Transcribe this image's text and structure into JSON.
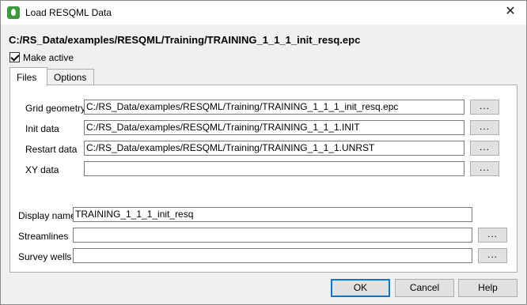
{
  "window": {
    "title": "Load RESQML Data",
    "close_label": "✕"
  },
  "filepath": "C:/RS_Data/examples/RESQML/Training/TRAINING_1_1_1_init_resq.epc",
  "make_active": {
    "label": "Make active",
    "checked": true
  },
  "tabs": [
    {
      "label": "Files",
      "active": true
    },
    {
      "label": "Options",
      "active": false
    }
  ],
  "files": {
    "grid_geometry": {
      "label": "Grid geometry",
      "value": "C:/RS_Data/examples/RESQML/Training/TRAINING_1_1_1_init_resq.epc"
    },
    "init_data": {
      "label": "Init data",
      "value": "C:/RS_Data/examples/RESQML/Training/TRAINING_1_1_1.INIT"
    },
    "restart_data": {
      "label": "Restart data",
      "value": "C:/RS_Data/examples/RESQML/Training/TRAINING_1_1_1.UNRST"
    },
    "xy_data": {
      "label": "XY data",
      "value": ""
    },
    "display_name": {
      "label": "Display name",
      "value": "TRAINING_1_1_1_init_resq"
    },
    "streamlines": {
      "label": "Streamlines",
      "value": ""
    },
    "survey_wells": {
      "label": "Survey wells",
      "value": ""
    },
    "browse_label": "..."
  },
  "buttons": {
    "ok": "OK",
    "cancel": "Cancel",
    "help": "Help"
  },
  "colors": {
    "accent": "#0078d7",
    "icon": "#3c9a3c"
  }
}
